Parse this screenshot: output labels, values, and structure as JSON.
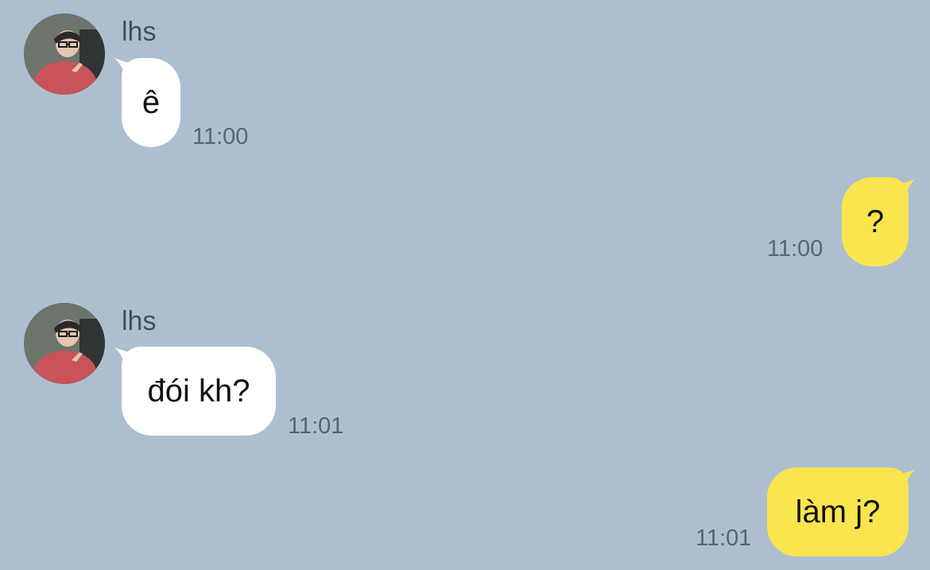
{
  "messages": [
    {
      "direction": "incoming",
      "sender": "lhs",
      "text": "ê",
      "time": "11:00"
    },
    {
      "direction": "outgoing",
      "text": "?",
      "time": "11:00"
    },
    {
      "direction": "incoming",
      "sender": "lhs",
      "text": "đói kh?",
      "time": "11:01"
    },
    {
      "direction": "outgoing",
      "text": "làm j?",
      "time": "11:01"
    }
  ],
  "colors": {
    "background": "#adbfcf",
    "incoming_bubble": "#ffffff",
    "outgoing_bubble": "#fae54f",
    "timestamp": "#5a646e",
    "sender_name": "#474d55"
  }
}
